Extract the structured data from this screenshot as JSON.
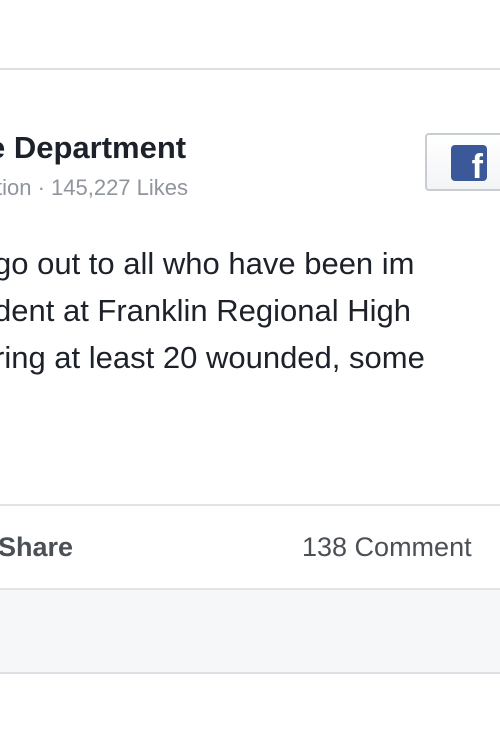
{
  "post": {
    "page_name": "e Department",
    "page_meta": "tion · 145,227 Likes",
    "body_lines": [
      "go out to all who have been im",
      "dent at Franklin Regional High",
      "ring at least 20 wounded, some"
    ],
    "share_label": "Share",
    "comments_label": "138 Comment"
  },
  "icons": {
    "fb_button_icon": "facebook-f-icon",
    "fb_glyph": "f"
  },
  "colors": {
    "brand": "#3b5998",
    "text": "#1d2129",
    "meta": "#90949c",
    "border": "#dcdfe4"
  }
}
